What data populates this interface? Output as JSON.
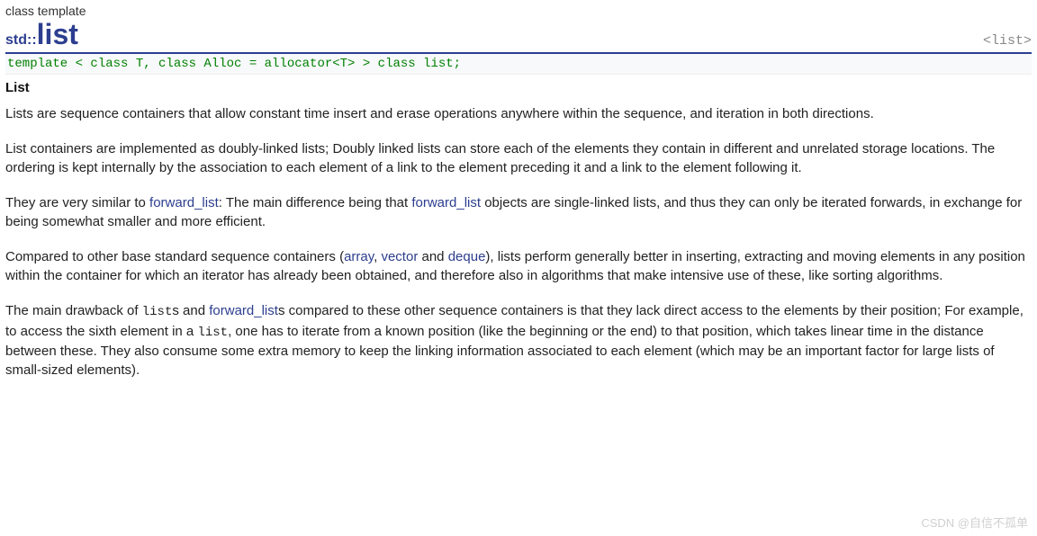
{
  "header": {
    "kind": "class template",
    "namespace": "std::",
    "title": "list",
    "include": "<list>"
  },
  "template_decl": "template < class T, class Alloc = allocator<T> > class list;",
  "section_title": "List",
  "paragraphs": {
    "p1": "Lists are sequence containers that allow constant time insert and erase operations anywhere within the sequence, and iteration in both directions.",
    "p2": "List containers are implemented as doubly-linked lists; Doubly linked lists can store each of the elements they contain in different and unrelated storage locations. The ordering is kept internally by the association to each element of a link to the element preceding it and a link to the element following it.",
    "p3_a": "They are very similar to ",
    "p3_link1": "forward_list",
    "p3_b": ": The main difference being that ",
    "p3_link2": "forward_list",
    "p3_c": " objects are single-linked lists, and thus they can only be iterated forwards, in exchange for being somewhat smaller and more efficient.",
    "p4_a": "Compared to other base standard sequence containers (",
    "p4_link1": "array",
    "p4_sep1": ", ",
    "p4_link2": "vector",
    "p4_sep2": " and ",
    "p4_link3": "deque",
    "p4_b": "), lists perform generally better in inserting, extracting and moving elements in any position within the container for which an iterator has already been obtained, and therefore also in algorithms that make intensive use of these, like sorting algorithms.",
    "p5_a": "The main drawback of ",
    "p5_mono1": "list",
    "p5_b": "s and ",
    "p5_link1": "forward_list",
    "p5_c": "s compared to these other sequence containers is that they lack direct access to the elements by their position; For example, to access the sixth element in a ",
    "p5_mono2": "list",
    "p5_d": ", one has to iterate from a known position (like the beginning or the end) to that position, which takes linear time in the distance between these. They also consume some extra memory to keep the linking information associated to each element (which may be an important factor for large lists of small-sized elements)."
  },
  "watermark": "CSDN @自信不孤单"
}
